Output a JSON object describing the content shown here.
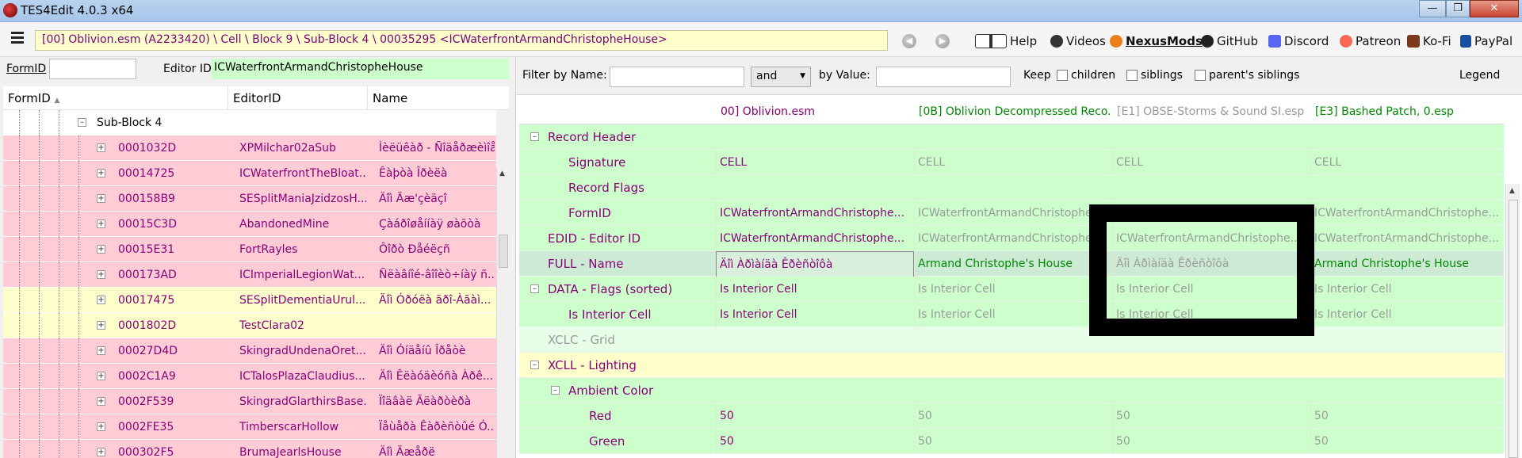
{
  "window": {
    "title": "TES4Edit 4.0.3 x64"
  },
  "toolbar": {
    "path": "[00] Oblivion.esm (A2233420) \\ Cell \\ Block 9 \\ Sub-Block 4 \\ 00035295 <ICWaterfrontArmandChristopheHouse>",
    "links": [
      "Help",
      "Videos",
      "NexusMods",
      "GitHub",
      "Discord",
      "Patreon",
      "Ko-Fi",
      "PayPal"
    ]
  },
  "left": {
    "formid_label": "FormID",
    "editorid_label": "Editor ID",
    "editorid_value": "ICWaterfrontArmandChristopheHouse",
    "columns": [
      "FormID",
      "EditorID",
      "Name"
    ],
    "parent_node": "Sub-Block 4",
    "rows": [
      {
        "formid": "0001032D",
        "editorid": "XPMilchar02aSub",
        "name": "Ìèëüêàð - Ñîäåðæèìîå",
        "color": "red"
      },
      {
        "formid": "00014725",
        "editorid": "ICWaterfrontTheBloat...",
        "name": "Êàþòà Îðèëà",
        "color": "red"
      },
      {
        "formid": "000158B9",
        "editorid": "SESplitManiaJzidzosH...",
        "name": "Äîì Äæ'çèäçî",
        "color": "red"
      },
      {
        "formid": "00015C3D",
        "editorid": "AbandonedMine",
        "name": "Çàáðîøåííàÿ øàõòà",
        "color": "red"
      },
      {
        "formid": "00015E31",
        "editorid": "FortRayles",
        "name": "Ôîðò Ðåéëçñ",
        "color": "red"
      },
      {
        "formid": "000173AD",
        "editorid": "ICImperialLegionWat...",
        "name": "Ñëàâíîé-âîîèò÷íàÿ ñ...",
        "color": "red"
      },
      {
        "formid": "00017475",
        "editorid": "SESplitDementiaUrul...",
        "name": "Äîì Óðóëà ãðî-Àãàì...",
        "color": "yellow"
      },
      {
        "formid": "0001802D",
        "editorid": "TestClara02",
        "name": "",
        "color": "yellow"
      },
      {
        "formid": "00027D4D",
        "editorid": "SkingradUndenaOret...",
        "name": "Äîì Óíäåíû Îðåòè",
        "color": "red"
      },
      {
        "formid": "0002C1A9",
        "editorid": "ICTalosPlazaClaudius...",
        "name": "Äîì Êëàóäèóñà Àðê...",
        "color": "red"
      },
      {
        "formid": "0002F539",
        "editorid": "SkingradGlarthirsBase...",
        "name": "Ïîäâàë Ãëàðòèðà",
        "color": "red"
      },
      {
        "formid": "0002FE35",
        "editorid": "TimberscarHollow",
        "name": "Ïåùåðà Êàðèñòûé Ó...",
        "color": "red"
      },
      {
        "formid": "000302F5",
        "editorid": "BrumaJearlsHouse",
        "name": "Äîì Äæåðë",
        "color": "red"
      }
    ]
  },
  "right": {
    "filter_by_name_label": "Filter by Name:",
    "and_option": "and",
    "by_value_label": "by Value:",
    "keep_label": "Keep",
    "children_label": "children",
    "siblings_label": "siblings",
    "parents_siblings_label": "parent's siblings",
    "legend_label": "Legend",
    "columns": [
      "00] Oblivion.esm",
      "[0B] Oblivion Decompressed Reco...",
      "[E1] OBSE-Storms & Sound SI.esp",
      "[E3] Bashed Patch, 0.esp"
    ],
    "rows": [
      {
        "name": "Record Header",
        "indent": 0,
        "toggle": "minus",
        "color": "green",
        "vals": [
          "",
          "",
          "",
          ""
        ]
      },
      {
        "name": "Signature",
        "indent": 1,
        "toggle": "",
        "color": "green",
        "vals": [
          "CELL",
          "CELL",
          "CELL",
          "CELL"
        ]
      },
      {
        "name": "Record Flags",
        "indent": 1,
        "toggle": "",
        "color": "green",
        "vals": [
          "",
          "",
          "",
          ""
        ]
      },
      {
        "name": "FormID",
        "indent": 1,
        "toggle": "",
        "color": "green",
        "vals": [
          "ICWaterfrontArmandChristophe...",
          "ICWaterfrontArmandChristophe...",
          "ICWaterfrontArmandChristophe...",
          "ICWaterfrontArmandChristophe..."
        ]
      },
      {
        "name": "EDID - Editor ID",
        "indent": 0,
        "toggle": "",
        "color": "green",
        "vals": [
          "ICWaterfrontArmandChristophe...",
          "ICWaterfrontArmandChristophe...",
          "ICWaterfrontArmandChristophe...",
          "ICWaterfrontArmandChristophe..."
        ]
      },
      {
        "name": "FULL - Name",
        "indent": 0,
        "toggle": "",
        "color": "sel",
        "vals": [
          "Äîì Àðìàíäà Êðèñòîôà",
          "Armand Christophe's House",
          "Äîì Àðìàíäà Êðèñòîôà",
          "Armand Christophe's House"
        ]
      },
      {
        "name": "DATA - Flags (sorted)",
        "indent": 0,
        "toggle": "minus",
        "color": "green",
        "vals": [
          "Is Interior Cell",
          "Is Interior Cell",
          "Is Interior Cell",
          "Is Interior Cell"
        ]
      },
      {
        "name": "Is Interior Cell",
        "indent": 1,
        "toggle": "",
        "color": "green",
        "vals": [
          "Is Interior Cell",
          "Is Interior Cell",
          "Is Interior Cell",
          "Is Interior Cell"
        ]
      },
      {
        "name": "XCLC - Grid",
        "indent": 0,
        "toggle": "",
        "color": "lgreen",
        "vals": [
          "",
          "",
          "",
          ""
        ]
      },
      {
        "name": "XCLL - Lighting",
        "indent": 0,
        "toggle": "minus",
        "color": "yellow",
        "vals": [
          "",
          "",
          "",
          ""
        ]
      },
      {
        "name": "Ambient Color",
        "indent": 1,
        "toggle": "minus",
        "color": "green",
        "vals": [
          "",
          "",
          "",
          ""
        ]
      },
      {
        "name": "Red",
        "indent": 2,
        "toggle": "",
        "color": "green",
        "vals": [
          "50",
          "50",
          "50",
          "50"
        ]
      },
      {
        "name": "Green",
        "indent": 2,
        "toggle": "",
        "color": "green",
        "vals": [
          "50",
          "50",
          "50",
          "50"
        ]
      }
    ]
  }
}
